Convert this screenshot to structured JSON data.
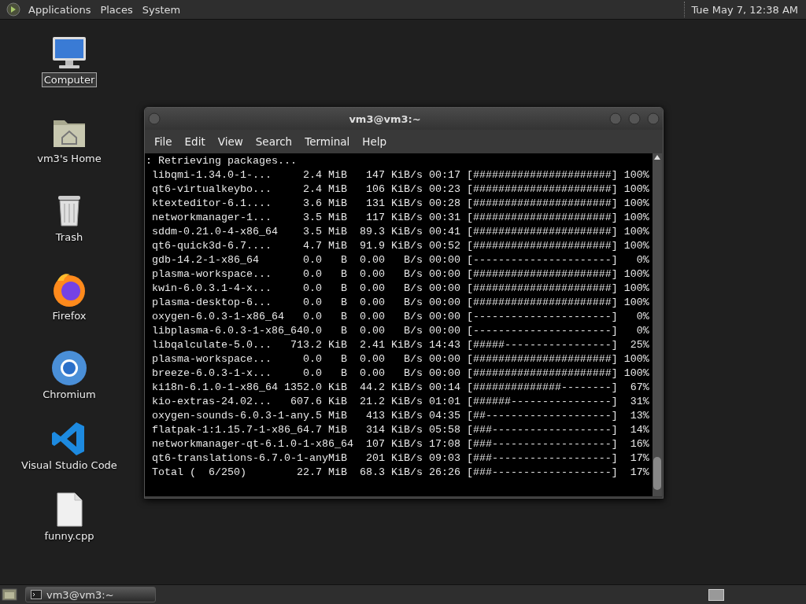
{
  "top_panel": {
    "menus": [
      "Applications",
      "Places",
      "System"
    ],
    "clock": "Tue May 7, 12:38 AM"
  },
  "desktop_icons": [
    {
      "label": "Computer",
      "kind": "computer",
      "selected": true
    },
    {
      "label": "vm3's Home",
      "kind": "home",
      "selected": false
    },
    {
      "label": "Trash",
      "kind": "trash",
      "selected": false
    },
    {
      "label": "Firefox",
      "kind": "firefox",
      "selected": false
    },
    {
      "label": "Chromium",
      "kind": "chromium",
      "selected": false
    },
    {
      "label": "Visual Studio Code",
      "kind": "vscode",
      "selected": false
    },
    {
      "label": "funny.cpp",
      "kind": "file",
      "selected": false
    }
  ],
  "terminal": {
    "title": "vm3@vm3:~",
    "menu": [
      "File",
      "Edit",
      "View",
      "Search",
      "Terminal",
      "Help"
    ],
    "lines": [
      ": Retrieving packages...",
      " libqmi-1.34.0-1-...     2.4 MiB   147 KiB/s 00:17 [######################] 100%",
      " qt6-virtualkeybo...     2.4 MiB   106 KiB/s 00:23 [######################] 100%",
      " ktexteditor-6.1....     3.6 MiB   131 KiB/s 00:28 [######################] 100%",
      " networkmanager-1...     3.5 MiB   117 KiB/s 00:31 [######################] 100%",
      " sddm-0.21.0-4-x86_64    3.5 MiB  89.3 KiB/s 00:41 [######################] 100%",
      " qt6-quick3d-6.7....     4.7 MiB  91.9 KiB/s 00:52 [######################] 100%",
      " gdb-14.2-1-x86_64       0.0   B  0.00   B/s 00:00 [----------------------]   0%",
      " plasma-workspace...     0.0   B  0.00   B/s 00:00 [######################] 100%",
      " kwin-6.0.3.1-4-x...     0.0   B  0.00   B/s 00:00 [######################] 100%",
      " plasma-desktop-6...     0.0   B  0.00   B/s 00:00 [######################] 100%",
      " oxygen-6.0.3-1-x86_64   0.0   B  0.00   B/s 00:00 [----------------------]   0%",
      " libplasma-6.0.3-1-x86_640.0   B  0.00   B/s 00:00 [----------------------]   0%",
      " libqalculate-5.0...   713.2 KiB  2.41 KiB/s 14:43 [#####-----------------]  25%",
      " plasma-workspace...     0.0   B  0.00   B/s 00:00 [######################] 100%",
      " breeze-6.0.3-1-x...     0.0   B  0.00   B/s 00:00 [######################] 100%",
      " ki18n-6.1.0-1-x86_64 1352.0 KiB  44.2 KiB/s 00:14 [##############--------]  67%",
      " kio-extras-24.02...   607.6 KiB  21.2 KiB/s 01:01 [######----------------]  31%",
      " oxygen-sounds-6.0.3-1-any.5 MiB   413 KiB/s 04:35 [##--------------------]  13%",
      " flatpak-1:1.15.7-1-x86_64.7 MiB   314 KiB/s 05:58 [###-------------------]  14%",
      " networkmanager-qt-6.1.0-1-x86_64  107 KiB/s 17:08 [###-------------------]  16%",
      " qt6-translations-6.7.0-1-anyMiB   201 KiB/s 09:03 [###-------------------]  17%",
      " Total (  6/250)        22.7 MiB  68.3 KiB/s 26:26 [###-------------------]  17%"
    ]
  },
  "taskbar": {
    "tasks": [
      {
        "label": "vm3@vm3:~",
        "selected": true
      }
    ]
  }
}
